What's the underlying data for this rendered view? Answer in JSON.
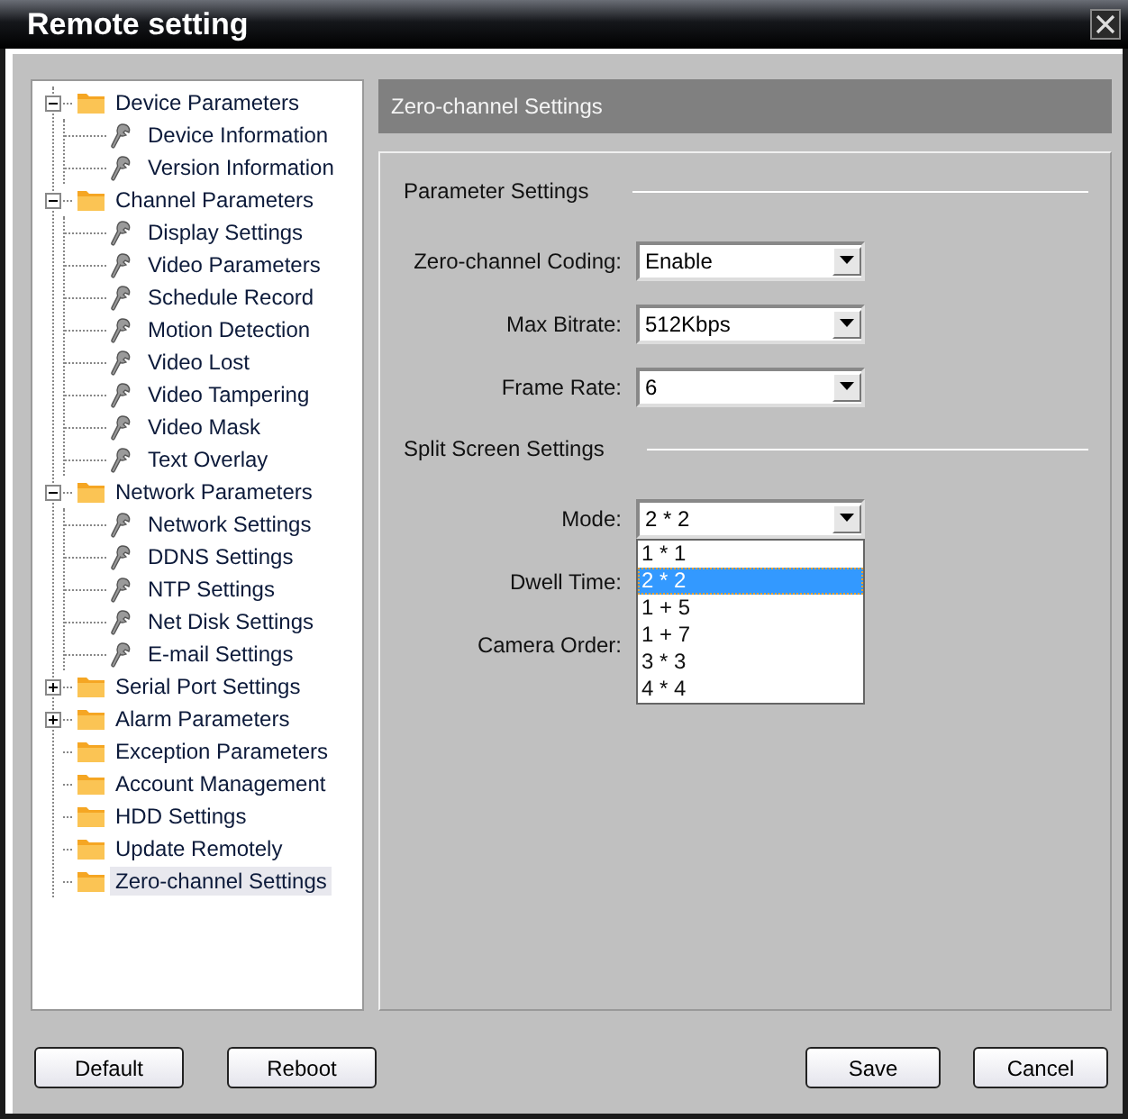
{
  "window": {
    "title": "Remote setting"
  },
  "tree": [
    {
      "label": "Device Parameters",
      "kind": "folder",
      "expanded": true,
      "selected": false,
      "children": [
        {
          "label": "Device Information",
          "kind": "leaf",
          "selected": false
        },
        {
          "label": "Version Information",
          "kind": "leaf",
          "selected": false
        }
      ]
    },
    {
      "label": "Channel Parameters",
      "kind": "folder",
      "expanded": true,
      "selected": false,
      "children": [
        {
          "label": "Display Settings",
          "kind": "leaf",
          "selected": false
        },
        {
          "label": "Video Parameters",
          "kind": "leaf",
          "selected": false
        },
        {
          "label": "Schedule Record",
          "kind": "leaf",
          "selected": false
        },
        {
          "label": "Motion Detection",
          "kind": "leaf",
          "selected": false
        },
        {
          "label": "Video Lost",
          "kind": "leaf",
          "selected": false
        },
        {
          "label": "Video Tampering",
          "kind": "leaf",
          "selected": false
        },
        {
          "label": "Video Mask",
          "kind": "leaf",
          "selected": false
        },
        {
          "label": "Text Overlay",
          "kind": "leaf",
          "selected": false
        }
      ]
    },
    {
      "label": "Network Parameters",
      "kind": "folder",
      "expanded": true,
      "selected": false,
      "children": [
        {
          "label": "Network Settings",
          "kind": "leaf",
          "selected": false
        },
        {
          "label": "DDNS Settings",
          "kind": "leaf",
          "selected": false
        },
        {
          "label": "NTP Settings",
          "kind": "leaf",
          "selected": false
        },
        {
          "label": "Net Disk Settings",
          "kind": "leaf",
          "selected": false
        },
        {
          "label": "E-mail Settings",
          "kind": "leaf",
          "selected": false
        }
      ]
    },
    {
      "label": "Serial Port Settings",
      "kind": "folder",
      "expanded": false,
      "selected": false
    },
    {
      "label": "Alarm Parameters",
      "kind": "folder",
      "expanded": false,
      "selected": false
    },
    {
      "label": "Exception Parameters",
      "kind": "folder",
      "selected": false
    },
    {
      "label": "Account Management",
      "kind": "folder",
      "selected": false
    },
    {
      "label": "HDD Settings",
      "kind": "folder",
      "selected": false
    },
    {
      "label": "Update Remotely",
      "kind": "folder",
      "selected": false
    },
    {
      "label": "Zero-channel Settings",
      "kind": "folder",
      "selected": true
    }
  ],
  "panel": {
    "title": "Zero-channel Settings",
    "sections": [
      {
        "title": "Parameter Settings",
        "fields": [
          {
            "label": "Zero-channel Coding:",
            "value": "Enable"
          },
          {
            "label": "Max Bitrate:",
            "value": "512Kbps"
          },
          {
            "label": "Frame Rate:",
            "value": "6"
          }
        ]
      },
      {
        "title": "Split Screen Settings",
        "fields": [
          {
            "label": "Mode:",
            "value": "2 * 2",
            "options": [
              {
                "label": "1 * 1",
                "selected": false
              },
              {
                "label": "2 * 2",
                "selected": true
              },
              {
                "label": "1 + 5",
                "selected": false
              },
              {
                "label": "1 + 7",
                "selected": false
              },
              {
                "label": "3 * 3",
                "selected": false
              },
              {
                "label": "4 * 4",
                "selected": false
              }
            ]
          },
          {
            "label": "Dwell Time:"
          },
          {
            "label": "Camera Order:"
          }
        ]
      }
    ]
  },
  "buttons_left": [
    "Default",
    "Reboot"
  ],
  "buttons_right": [
    "Save",
    "Cancel"
  ]
}
